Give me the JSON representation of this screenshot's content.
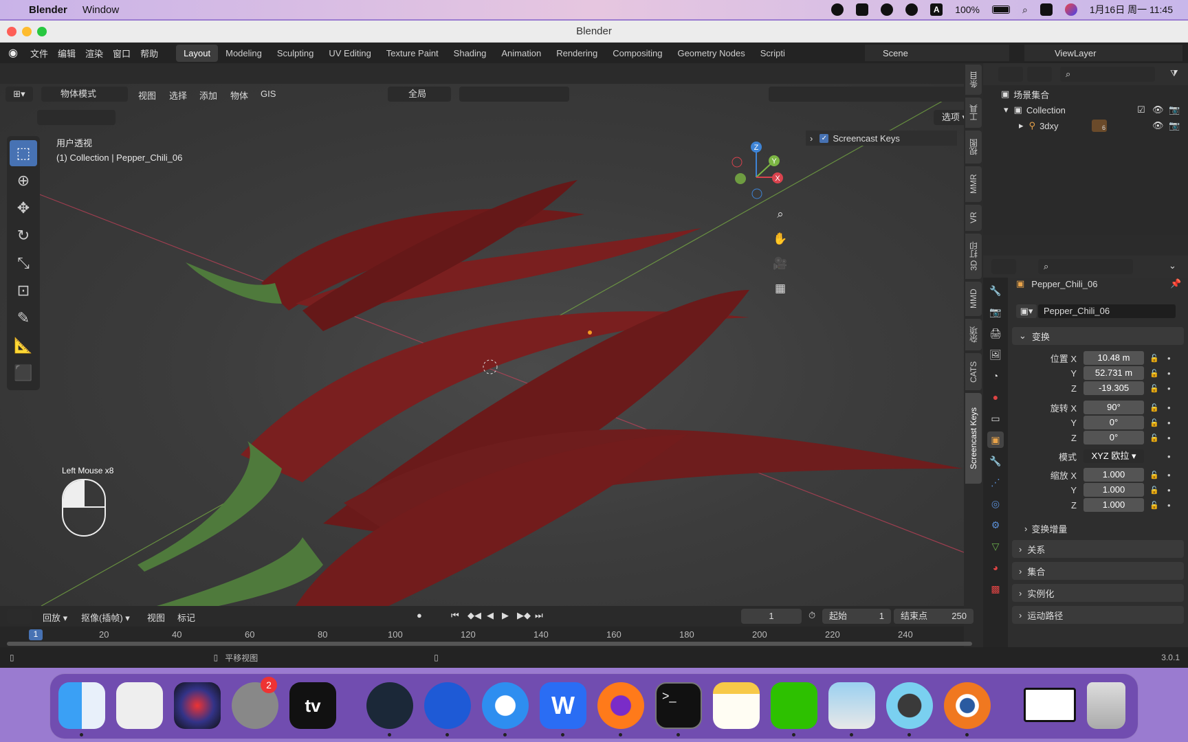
{
  "menubar": {
    "apple": "",
    "app_name": "Blender",
    "window_menu": "Window",
    "battery": "100%",
    "clock": "1月16日 周一 11:45"
  },
  "window": {
    "title": "Blender"
  },
  "topbar": {
    "menus": [
      "文件",
      "编辑",
      "渲染",
      "窗口",
      "帮助"
    ],
    "workspaces": [
      "Layout",
      "Modeling",
      "Sculpting",
      "UV Editing",
      "Texture Paint",
      "Shading",
      "Animation",
      "Rendering",
      "Compositing",
      "Geometry Nodes",
      "Scripti"
    ],
    "active_workspace": "Layout",
    "scene": "Scene",
    "view_layer": "ViewLayer"
  },
  "viewport": {
    "mode": "物体模式",
    "menus": [
      "视图",
      "选择",
      "添加",
      "物体",
      "GIS"
    ],
    "transform_orientation": "全局",
    "options_label": "选项",
    "view_name": "用户透视",
    "object_path": "(1) Collection | Pepper_Chili_06",
    "screencast_keys_label": "Screencast Keys",
    "screencast_text": "Left Mouse x8",
    "gizmo_axes": {
      "x": "X",
      "y": "Y",
      "z": "Z"
    }
  },
  "side_tabs": [
    "条目",
    "工具",
    "视图",
    "MMR",
    "VR",
    "3D 打印",
    "MMD",
    "杂项",
    "CATS",
    "Screencast Keys"
  ],
  "outliner": {
    "root": "场景集合",
    "collection": "Collection",
    "child": "3dxy",
    "child_count": "6"
  },
  "properties": {
    "object_name_header": "Pepper_Chili_06",
    "object_name_field": "Pepper_Chili_06",
    "transform_section": "变换",
    "location_label": "位置 X",
    "location": {
      "x": "10.48 m",
      "y": "52.731 m",
      "z": "-19.305"
    },
    "rotation_label": "旋转 X",
    "rotation": {
      "x": "90°",
      "y": "0°",
      "z": "0°"
    },
    "mode_label": "模式",
    "mode_value": "XYZ 欧拉",
    "scale_label": "缩放 X",
    "scale": {
      "x": "1.000",
      "y": "1.000",
      "z": "1.000"
    },
    "y_label": "Y",
    "z_label": "Z",
    "delta_section": "变换增量",
    "relations_section": "关系",
    "collections_section": "集合",
    "instancing_section": "实例化",
    "motion_paths_section": "运动路径"
  },
  "timeline": {
    "playback": "回放",
    "keying": "抠像(插帧)",
    "view": "视图",
    "marker": "标记",
    "current_frame": "1",
    "start_label": "起始",
    "start": "1",
    "end_label": "结束点",
    "end": "250",
    "ruler": [
      "1",
      "20",
      "40",
      "60",
      "80",
      "100",
      "120",
      "140",
      "160",
      "180",
      "200",
      "220",
      "240"
    ]
  },
  "statusbar": {
    "pan_view": "平移视图",
    "version": "3.0.1"
  },
  "dock": {
    "settings_badge": "2",
    "tv_label": "tv"
  },
  "colors": {
    "accent": "#4772b3",
    "chili": "#7a1f1f",
    "stem": "#4f7a3c",
    "x_axis": "#d9434e",
    "y_axis": "#7cb544",
    "z_axis": "#3e84d6"
  }
}
